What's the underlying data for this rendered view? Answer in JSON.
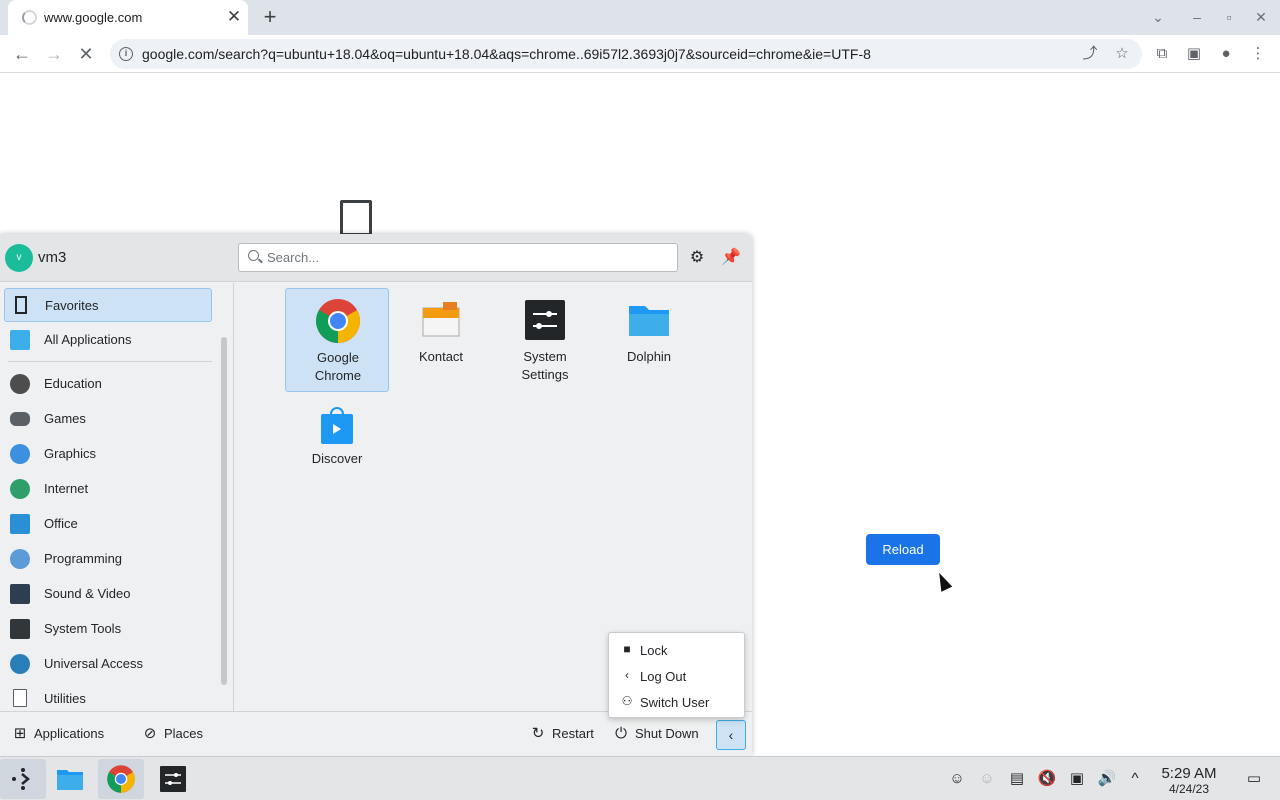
{
  "browser": {
    "tab_title": "www.google.com",
    "tab_close": "✕",
    "new_tab": "+",
    "url": "google.com/search?q=ubuntu+18.04&oq=ubuntu+18.04&aqs=chrome..69i57l2.3693j0j7&sourceid=chrome&ie=UTF-8",
    "reload_label": "Reload"
  },
  "launcher": {
    "username": "vm3",
    "avatar_initial": "v",
    "search_placeholder": "Search...",
    "categories": [
      {
        "label": "Favorites"
      },
      {
        "label": "All Applications"
      },
      {
        "label": "Education"
      },
      {
        "label": "Games"
      },
      {
        "label": "Graphics"
      },
      {
        "label": "Internet"
      },
      {
        "label": "Office"
      },
      {
        "label": "Programming"
      },
      {
        "label": "Sound & Video"
      },
      {
        "label": "System Tools"
      },
      {
        "label": "Universal Access"
      },
      {
        "label": "Utilities"
      }
    ],
    "apps": [
      {
        "line1": "Google",
        "line2": "Chrome"
      },
      {
        "line1": "Kontact",
        "line2": ""
      },
      {
        "line1": "System",
        "line2": "Settings"
      },
      {
        "line1": "Dolphin",
        "line2": ""
      },
      {
        "line1": "Discover",
        "line2": ""
      }
    ],
    "footer": {
      "applications": "Applications",
      "places": "Places",
      "restart": "Restart",
      "shutdown": "Shut Down"
    },
    "session_menu": [
      {
        "label": "Lock"
      },
      {
        "label": "Log Out"
      },
      {
        "label": "Switch User"
      }
    ]
  },
  "taskbar": {
    "time": "5:29 AM",
    "date": "4/24/23"
  },
  "colors": {
    "accent": "#3daee9",
    "reload_button": "#1a73e8",
    "selection": "#cde3f5"
  }
}
